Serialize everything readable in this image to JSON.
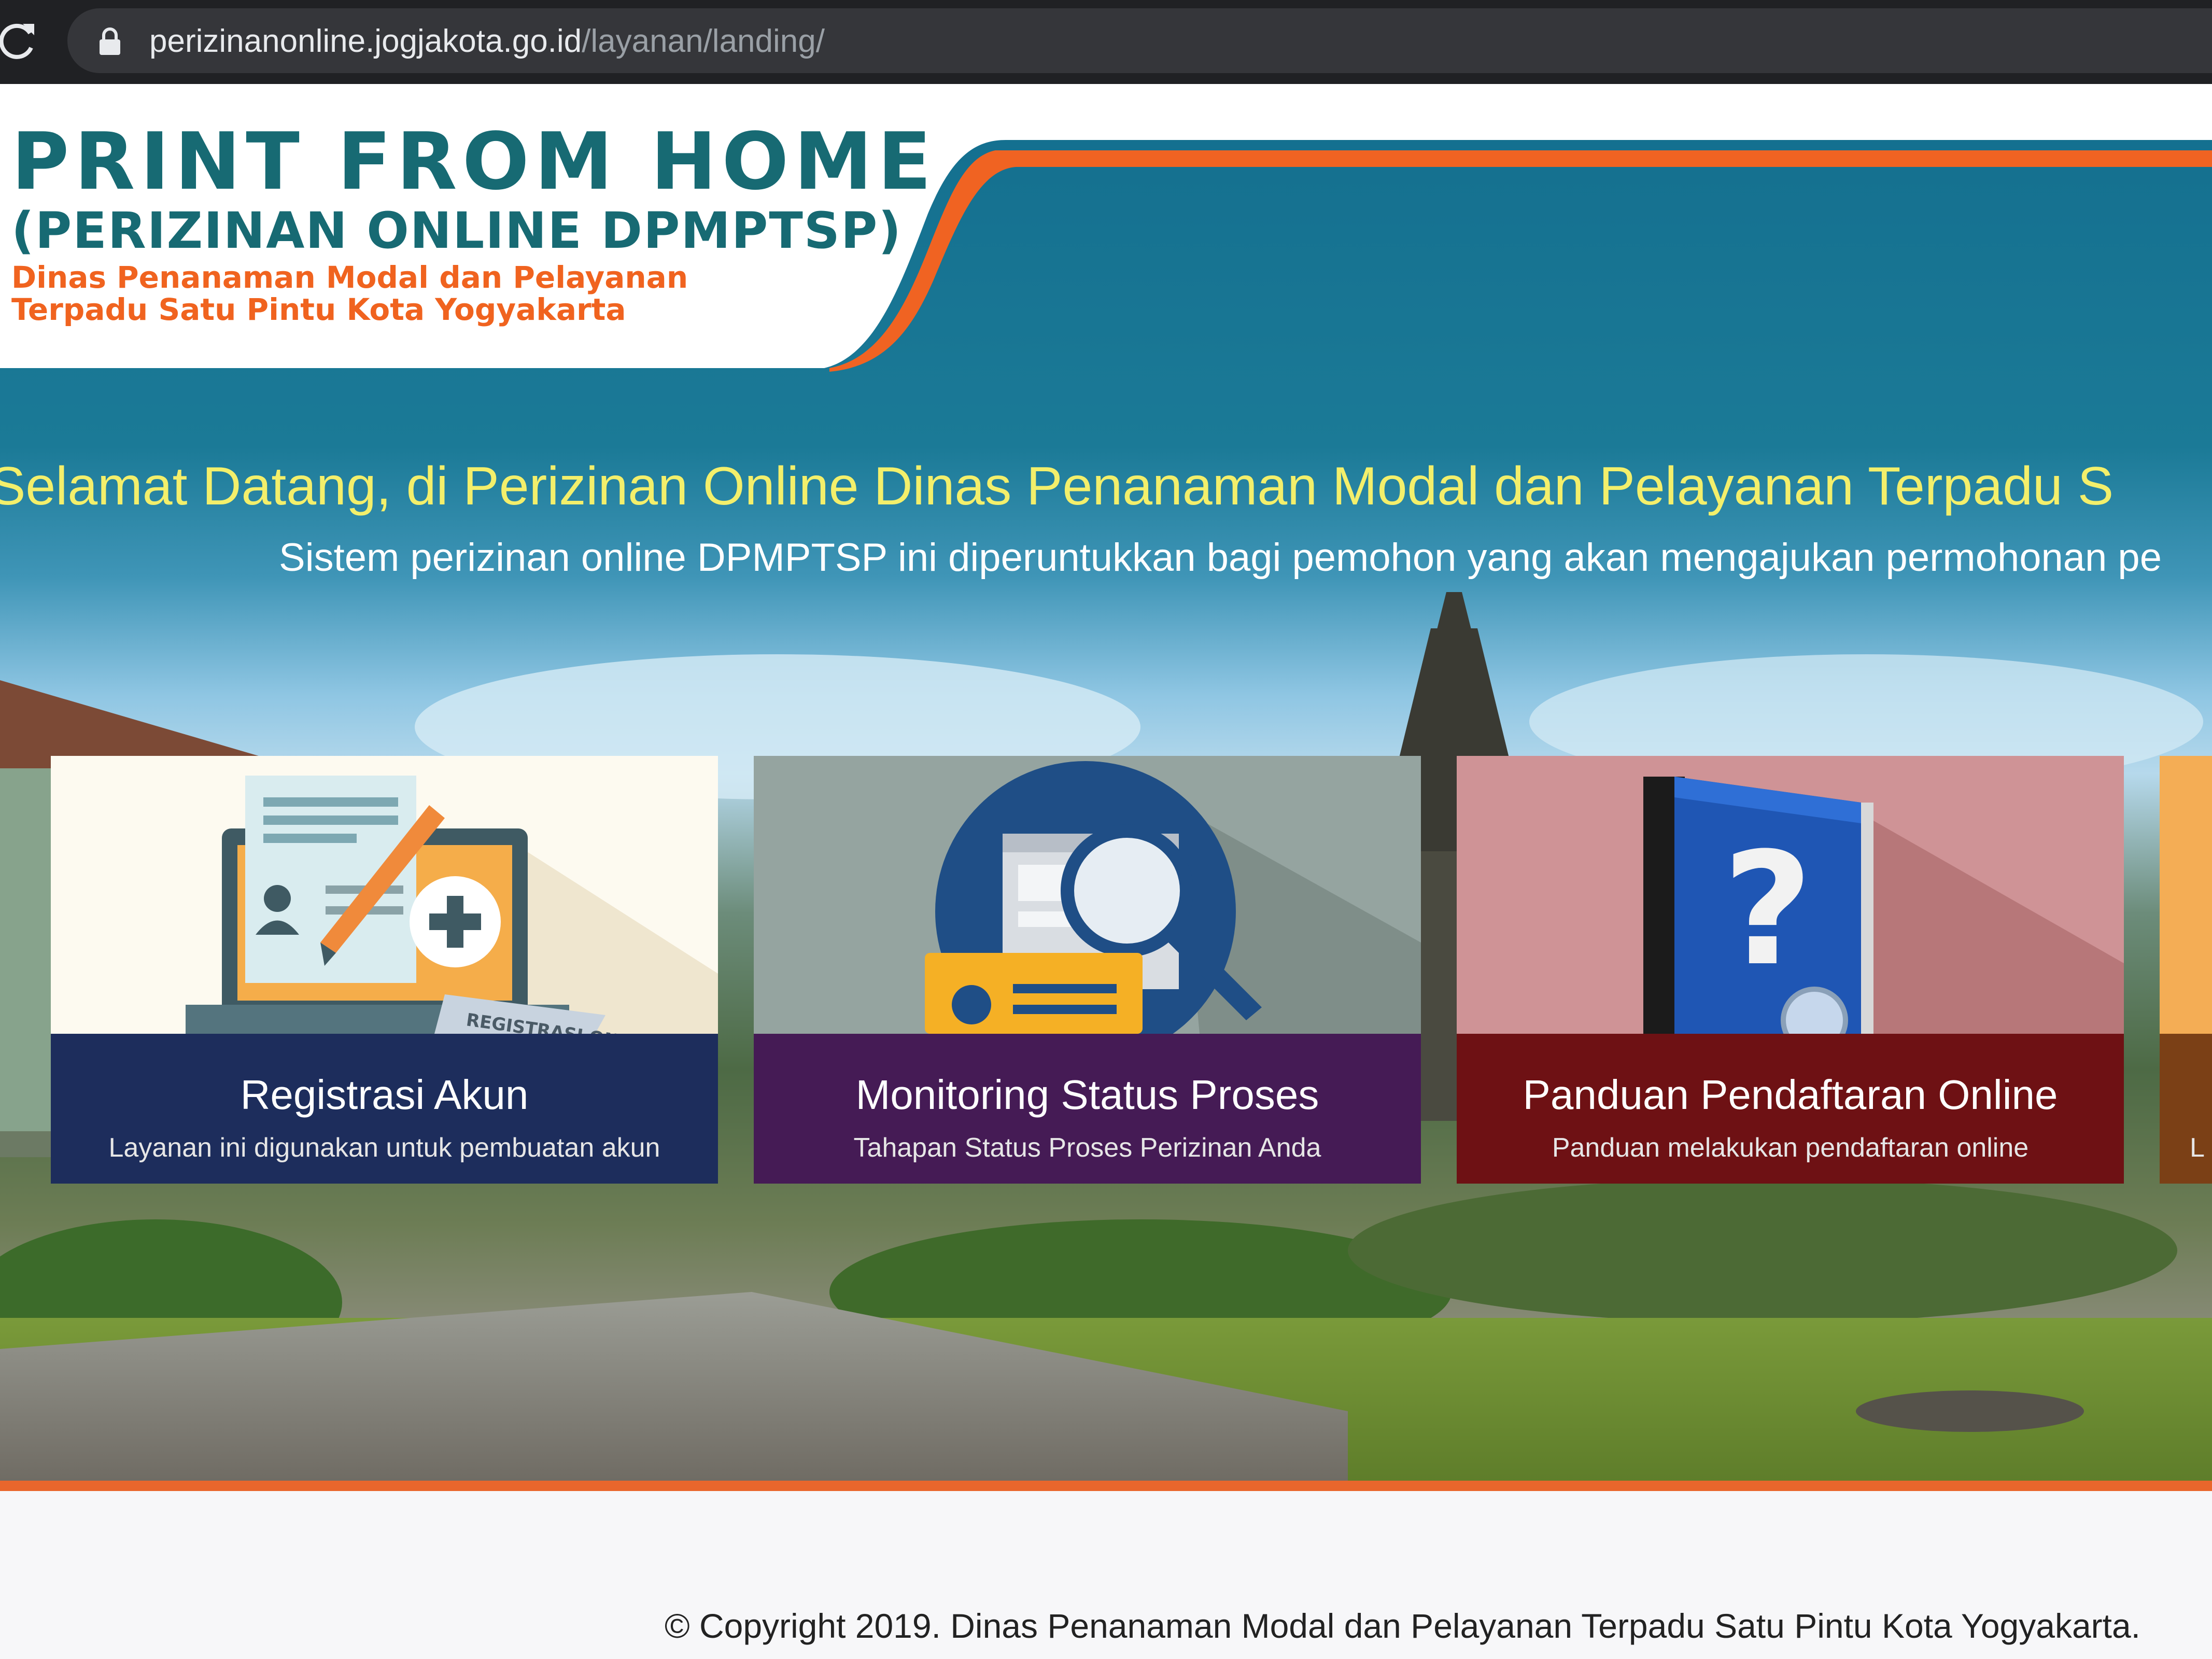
{
  "browser": {
    "url_host": "perizinanonline.jogjakota.go.id",
    "url_path": "/layanan/landing/"
  },
  "header": {
    "title": "PRINT FROM HOME",
    "subtitle": "(PERIZINAN ONLINE DPMPTSP)",
    "agency": "Dinas Penanaman Modal dan Pelayanan Terpadu Satu Pintu Kota Yogyakarta"
  },
  "hero": {
    "welcome": "Selamat Datang, di Perizinan Online Dinas Penanaman Modal dan Pelayanan Terpadu S",
    "intro": "Sistem perizinan online DPMPTSP ini diperuntukkan bagi pemohon yang akan mengajukan permohonan pe"
  },
  "cards": [
    {
      "title": "Registrasi Akun",
      "desc": "Layanan ini digunakan untuk pembuatan akun",
      "art_label": "REGISTRASI ONLINE"
    },
    {
      "title": "Monitoring Status Proses",
      "desc": "Tahapan Status Proses Perizinan Anda"
    },
    {
      "title": "Panduan Pendaftaran Online",
      "desc": "Panduan melakukan pendaftaran online"
    },
    {
      "title": "",
      "desc": "L"
    }
  ],
  "footer": {
    "copyright": "© Copyright 2019. Dinas Penanaman Modal dan Pelayanan Terpadu Satu Pintu Kota Yogyakarta."
  },
  "colors": {
    "browser_bar": "#202124",
    "header_teal": "#136e8e",
    "accent_orange": "#f0631f",
    "welcome_yellow": "#f3ef6b",
    "card1_caption": "#1d2d5c",
    "card2_caption": "#451b55",
    "card3_caption": "#6e1114",
    "card4_caption": "#7b4016"
  }
}
